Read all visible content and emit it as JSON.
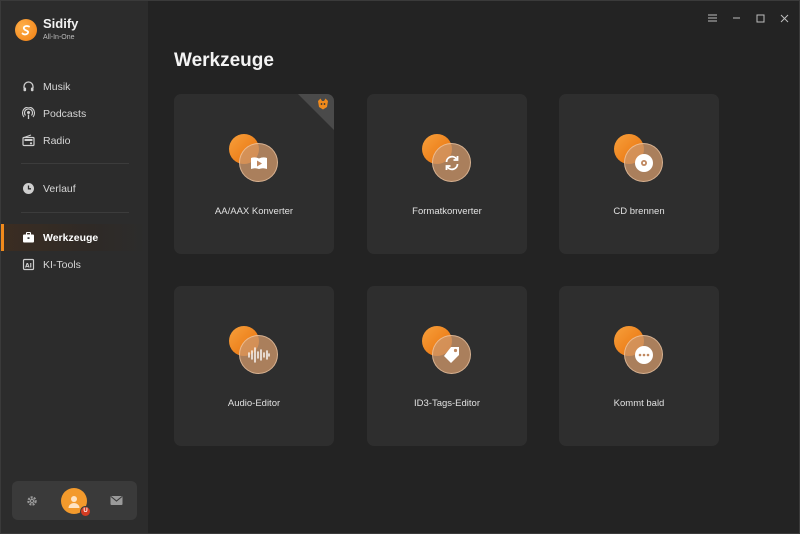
{
  "app": {
    "name": "Sidify",
    "subtitle": "All-In-One"
  },
  "sidebar": {
    "items": [
      {
        "label": "Musik",
        "icon": "headphones-icon"
      },
      {
        "label": "Podcasts",
        "icon": "podcast-icon"
      },
      {
        "label": "Radio",
        "icon": "radio-icon"
      },
      {
        "label": "Verlauf",
        "icon": "clock-icon"
      },
      {
        "label": "Werkzeuge",
        "icon": "toolbox-icon",
        "active": true
      },
      {
        "label": "KI-Tools",
        "icon": "ai-icon"
      }
    ]
  },
  "user_panel": {
    "settings_icon": "gear-icon",
    "avatar_badge": "U",
    "mail_icon": "mail-icon"
  },
  "window_controls": [
    "menu-icon",
    "minimize-icon",
    "maximize-icon",
    "close-icon"
  ],
  "main": {
    "title": "Werkzeuge",
    "tools": [
      {
        "label": "AA/AAX Konverter",
        "icon": "audiobook-play-icon",
        "premium_badge": true
      },
      {
        "label": "Formatkonverter",
        "icon": "convert-icon"
      },
      {
        "label": "CD brennen",
        "icon": "disc-icon"
      },
      {
        "label": "Audio-Editor",
        "icon": "waveform-icon"
      },
      {
        "label": "ID3-Tags-Editor",
        "icon": "tag-icon"
      },
      {
        "label": "Kommt bald",
        "icon": "more-icon"
      }
    ]
  },
  "colors": {
    "accent": "#f08a1c",
    "sidebar_bg": "#2c2c2c",
    "main_bg": "#232323",
    "card_bg": "#2e2e2e"
  }
}
